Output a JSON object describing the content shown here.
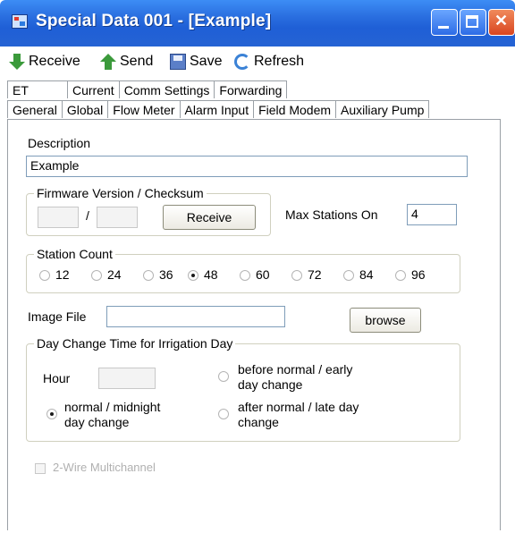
{
  "window": {
    "title": "Special Data 001 - [Example]"
  },
  "toolbar": {
    "receive": "Receive",
    "send": "Send",
    "save": "Save",
    "refresh": "Refresh"
  },
  "tabs_row1": [
    "ET",
    "Current",
    "Comm Settings",
    "Forwarding"
  ],
  "tabs_row2": [
    "General",
    "Global",
    "Flow Meter",
    "Alarm Input",
    "Field Modem",
    "Auxiliary Pump"
  ],
  "general": {
    "description_label": "Description",
    "description_value": "Example",
    "firmware_group": "Firmware Version / Checksum",
    "firmware_separator": "/",
    "firmware_receive": "Receive",
    "max_stations_label": "Max Stations On",
    "max_stations_value": "4",
    "station_count_group": "Station Count",
    "station_options": [
      "12",
      "24",
      "36",
      "48",
      "60",
      "72",
      "84",
      "96"
    ],
    "station_selected": "48",
    "image_file_label": "Image File",
    "image_file_value": "",
    "browse": "browse",
    "day_change_group": "Day Change Time for Irrigation Day",
    "hour_label": "Hour",
    "opt_before_1": "before normal / early",
    "opt_before_2": "day change",
    "opt_normal_1": "normal / midnight",
    "opt_normal_2": "day change",
    "opt_after_1": "after normal / late day",
    "opt_after_2": "change",
    "day_change_selected": "normal / midnight day change",
    "two_wire_label": "2-Wire Multichannel"
  }
}
